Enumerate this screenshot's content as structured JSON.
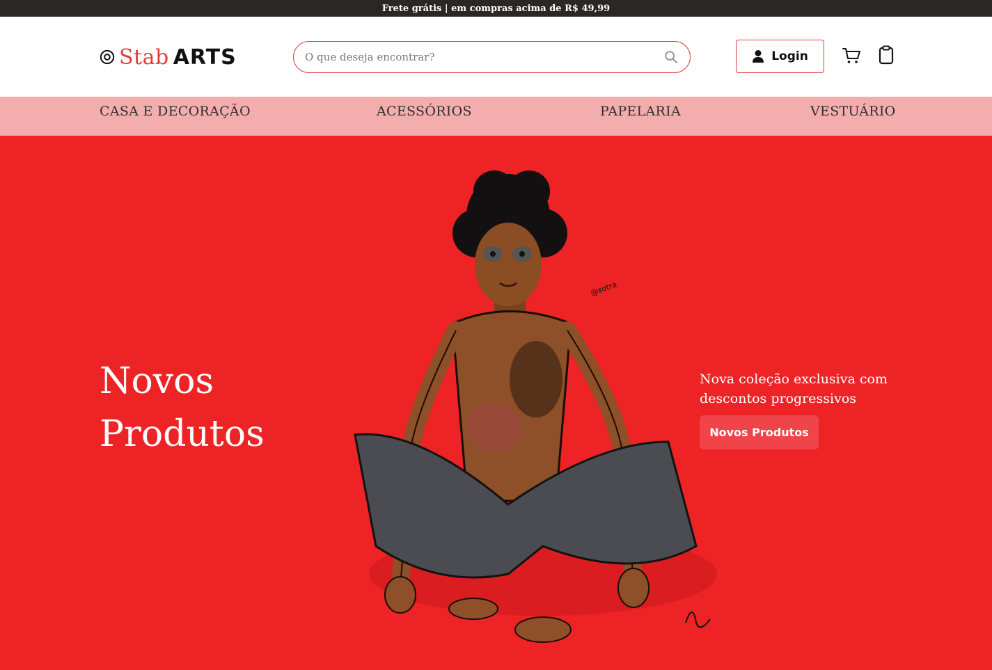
{
  "promo_bar": {
    "text": "Frete grátis | em compras acima de R$ 49,99"
  },
  "header": {
    "logo": {
      "word1": "Stab",
      "word2": "ARTS",
      "mark_icon": "target-icon"
    },
    "search": {
      "placeholder": "O que deseja encontrar?",
      "value": "",
      "icon": "search-icon"
    },
    "login_label": "Login",
    "login_icon": "user-icon",
    "cart_icon": "cart-icon",
    "orders_icon": "clipboard-icon"
  },
  "nav": {
    "items": [
      {
        "label": "CASA E DECORAÇÃO"
      },
      {
        "label": "ACESSÓRIOS"
      },
      {
        "label": "PAPELARIA"
      },
      {
        "label": "VESTUÁRIO"
      }
    ]
  },
  "hero": {
    "title_line1": "Novos",
    "title_line2": "Produtos",
    "description": "Nova coleção exclusiva com descontos progressivos",
    "cta_label": "Novos Produtos",
    "image_signature": "@sotra",
    "colors": {
      "background": "#ee2326",
      "accent": "#e23b3b",
      "nav_bg": "#f3adad",
      "promo_bg": "#2b2727"
    }
  }
}
